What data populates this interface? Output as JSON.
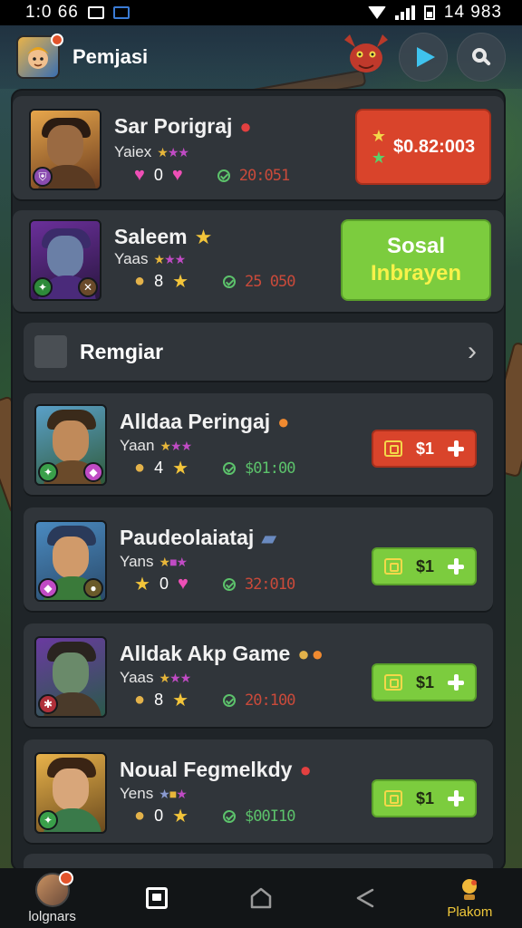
{
  "status_bar": {
    "time": "1:0 66",
    "right_text": "14 983"
  },
  "header": {
    "title": "Pemjasi"
  },
  "featured": [
    {
      "name": "Sar Porigraj",
      "subtitle": "Yaiex",
      "stat_value": "0",
      "time": "20:051",
      "cta_label": "$0.82:003"
    },
    {
      "name": "Saleem",
      "subtitle": "Yaas",
      "stat_value": "8",
      "time": "25 050",
      "cta_line1": "Sosal",
      "cta_line2": "Inbrayen"
    }
  ],
  "section": {
    "title": "Remgiar"
  },
  "list_items": [
    {
      "name": "Alldaa Peringaj",
      "subtitle": "Yaan",
      "stat_value": "4",
      "time": "$01:00",
      "price": "$1",
      "button_color": "red"
    },
    {
      "name": "Paudeolaiataj",
      "subtitle": "Yans",
      "stat_value": "0",
      "time": "32:010",
      "price": "$1",
      "button_color": "green"
    },
    {
      "name": "Alldak Akp Game",
      "subtitle": "Yaas",
      "stat_value": "8",
      "time": "20:100",
      "price": "$1",
      "button_color": "green"
    },
    {
      "name": "Noual Fegmelkdy",
      "subtitle": "Yens",
      "stat_value": "0",
      "time": "$00I10",
      "price": "$1",
      "button_color": "green"
    }
  ],
  "bottom_nav": [
    {
      "label": "lolgnars",
      "icon": "profile-avatar-icon"
    },
    {
      "label": "",
      "icon": "card-icon"
    },
    {
      "label": "",
      "icon": "home-icon"
    },
    {
      "label": "",
      "icon": "share-icon"
    },
    {
      "label": "Plakom",
      "icon": "trophy-icon"
    }
  ],
  "colors": {
    "accent_red": "#d9442b",
    "accent_green": "#7ccc3e",
    "panel": "#1f2428",
    "card": "#30353a",
    "time_green": "#5cc26b",
    "time_red": "#c94a3a"
  }
}
